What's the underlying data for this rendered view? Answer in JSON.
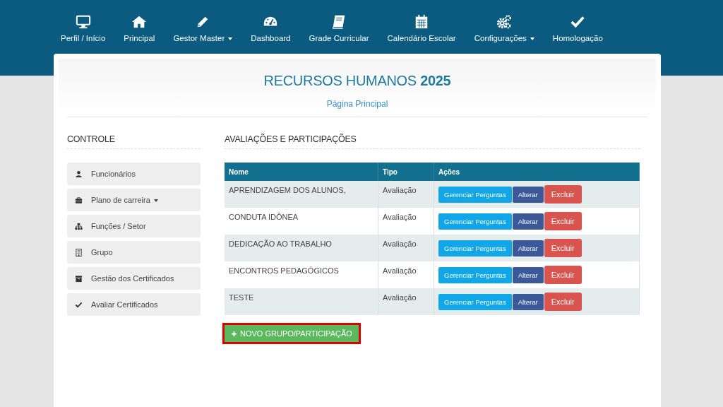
{
  "nav": [
    {
      "label": "Perfil / Início",
      "dropdown": false
    },
    {
      "label": "Principal",
      "dropdown": false
    },
    {
      "label": "Gestor Master",
      "dropdown": true
    },
    {
      "label": "Dashboard",
      "dropdown": false
    },
    {
      "label": "Grade Curricular",
      "dropdown": false
    },
    {
      "label": "Calendário Escolar",
      "dropdown": false
    },
    {
      "label": "Configurações",
      "dropdown": true
    },
    {
      "label": "Homologação",
      "dropdown": false
    }
  ],
  "header": {
    "title": "RECURSOS HUMANOS **2025**",
    "subtitle": "Página Principal"
  },
  "sidebar": {
    "title": "CONTROLE",
    "items": [
      {
        "label": "Funcionários",
        "dropdown": false
      },
      {
        "label": "Plano de carreira",
        "dropdown": true
      },
      {
        "label": "Funções / Setor",
        "dropdown": false
      },
      {
        "label": "Grupo",
        "dropdown": false
      },
      {
        "label": "Gestão dos Certificados",
        "dropdown": false
      },
      {
        "label": "Avaliar Certificados",
        "dropdown": false
      }
    ]
  },
  "section": {
    "title": "AVALIAÇÕES E PARTICIPAÇÕES"
  },
  "table": {
    "columns": [
      "Nome",
      "Tipo",
      "Ações"
    ],
    "rows": [
      {
        "name": "APRENDIZAGEM DOS ALUNOS,",
        "type": "Avaliação",
        "actions": [
          "Gerenciar Perguntas",
          "Alterar",
          "Excluir"
        ]
      },
      {
        "name": "CONDUTA IDÔNEA",
        "type": "Avaliação",
        "actions": [
          "Gerenciar Perguntas",
          "Alterar",
          "Excluir"
        ]
      },
      {
        "name": "DEDICAÇÃO AO TRABALHO",
        "type": "Avaliação",
        "actions": [
          "Gerenciar Perguntas",
          "Alterar",
          "Excluir"
        ]
      },
      {
        "name": "ENCONTROS PEDAGÓGICOS",
        "type": "Avaliação",
        "actions": [
          "Gerenciar Perguntas",
          "Alterar",
          "Excluir"
        ]
      },
      {
        "name": "TESTE",
        "type": "Avaliação",
        "actions": [
          "Gerenciar Perguntas",
          "Alterar",
          "Excluir"
        ]
      }
    ]
  },
  "new_button": {
    "label": "NOVO GRUPO/PARTICIPAÇÃO",
    "highlighted": true
  }
}
